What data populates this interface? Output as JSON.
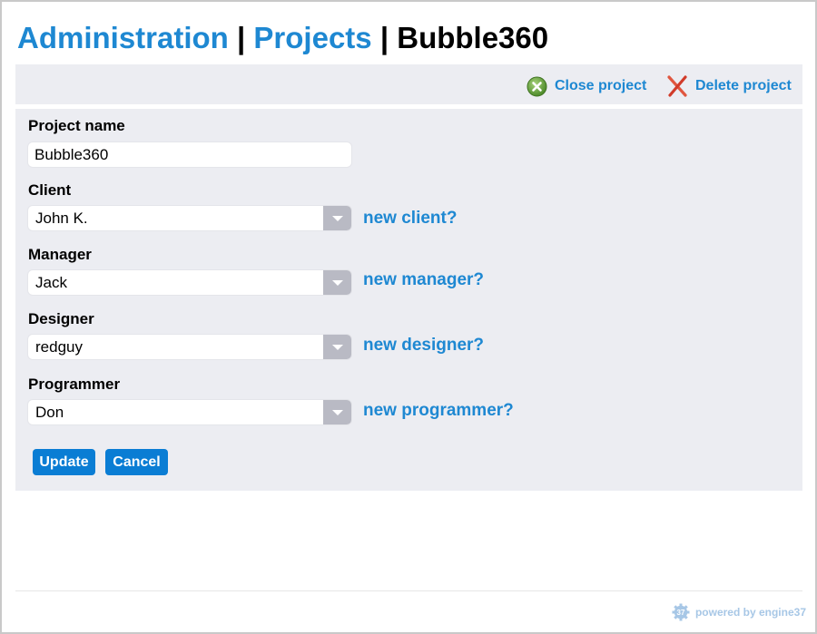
{
  "header": {
    "crumb_admin": "Administration",
    "separator": "|",
    "crumb_projects": "Projects",
    "current": "Bubble360"
  },
  "toolbar": {
    "close_label": "Close project",
    "delete_label": "Delete project",
    "close_icon": "close-circle-icon",
    "delete_icon": "x-icon"
  },
  "form": {
    "project_name": {
      "label": "Project name",
      "value": "Bubble360"
    },
    "client": {
      "label": "Client",
      "value": "John K.",
      "new_link": "new client?"
    },
    "manager": {
      "label": "Manager",
      "value": "Jack",
      "new_link": "new manager?"
    },
    "designer": {
      "label": "Designer",
      "value": "redguy",
      "new_link": "new designer?"
    },
    "programmer": {
      "label": "Programmer",
      "value": "Don",
      "new_link": "new programmer?"
    },
    "update_label": "Update",
    "cancel_label": "Cancel"
  },
  "footer": {
    "badge": "37",
    "powered_by": "powered by engine37"
  },
  "colors": {
    "accent": "#1e88d2",
    "button": "#0a7dd4",
    "panel": "#ecedf2"
  }
}
